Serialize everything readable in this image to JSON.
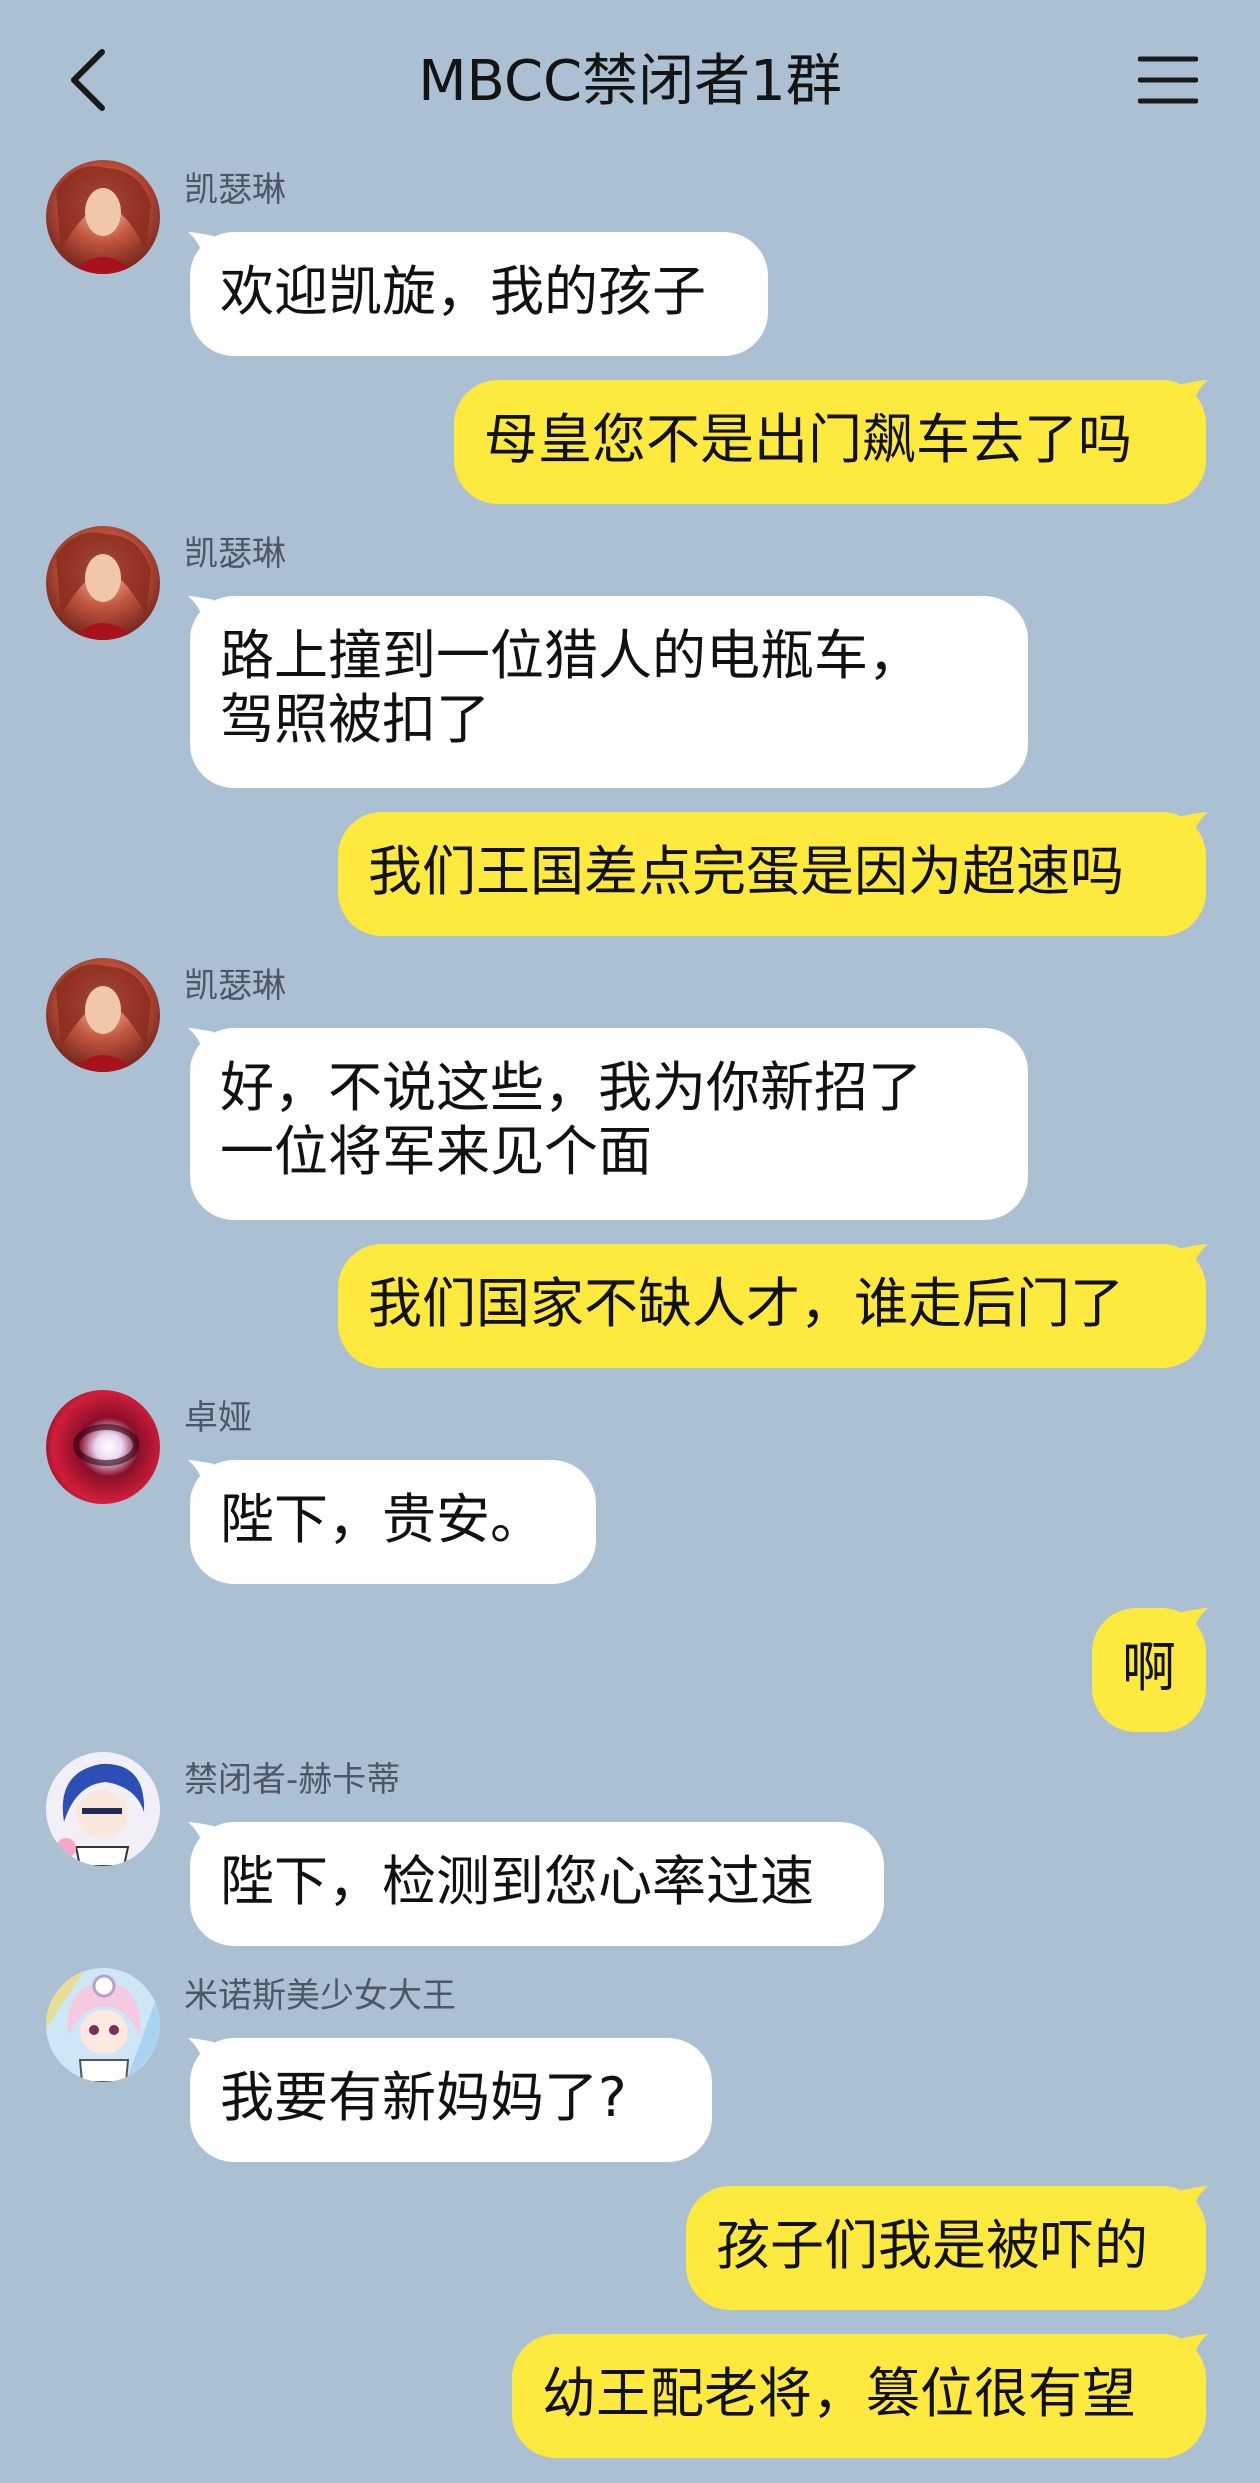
{
  "header": {
    "title": "MBCC禁闭者1群",
    "back_icon": "chevron-left-icon",
    "menu_icon": "hamburger-menu-icon"
  },
  "colors": {
    "background": "#abc1d3",
    "incoming_bubble": "#ffffff",
    "outgoing_bubble": "#fee93f",
    "sender_name": "#4d5866"
  },
  "messages": [
    {
      "direction": "in",
      "sender": "凯瑟琳",
      "avatar": "catherine-avatar",
      "text": "欢迎凯旋，我的孩子"
    },
    {
      "direction": "out",
      "text": "母皇您不是出门飙车去了吗"
    },
    {
      "direction": "in",
      "sender": "凯瑟琳",
      "avatar": "catherine-avatar",
      "text": "路上撞到一位猎人的电瓶车，\n驾照被扣了"
    },
    {
      "direction": "out",
      "text": "我们王国差点完蛋是因为超速吗"
    },
    {
      "direction": "in",
      "sender": "凯瑟琳",
      "avatar": "catherine-avatar",
      "text": "好，不说这些，我为你新招了\n一位将军来见个面"
    },
    {
      "direction": "out",
      "text": "我们国家不缺人才，谁走后门了"
    },
    {
      "direction": "in",
      "sender": "卓娅",
      "avatar": "zoya-avatar",
      "text": "陛下，贵安。"
    },
    {
      "direction": "out",
      "text": "啊"
    },
    {
      "direction": "in",
      "sender": "禁闭者-赫卡蒂",
      "avatar": "hecate-avatar",
      "text": "陛下，检测到您心率过速"
    },
    {
      "direction": "in",
      "sender": "米诺斯美少女大王",
      "avatar": "minos-avatar",
      "text": "我要有新妈妈了?"
    },
    {
      "direction": "out",
      "text": "孩子们我是被吓的"
    },
    {
      "direction": "out",
      "text": "幼王配老将，篡位很有望"
    }
  ]
}
